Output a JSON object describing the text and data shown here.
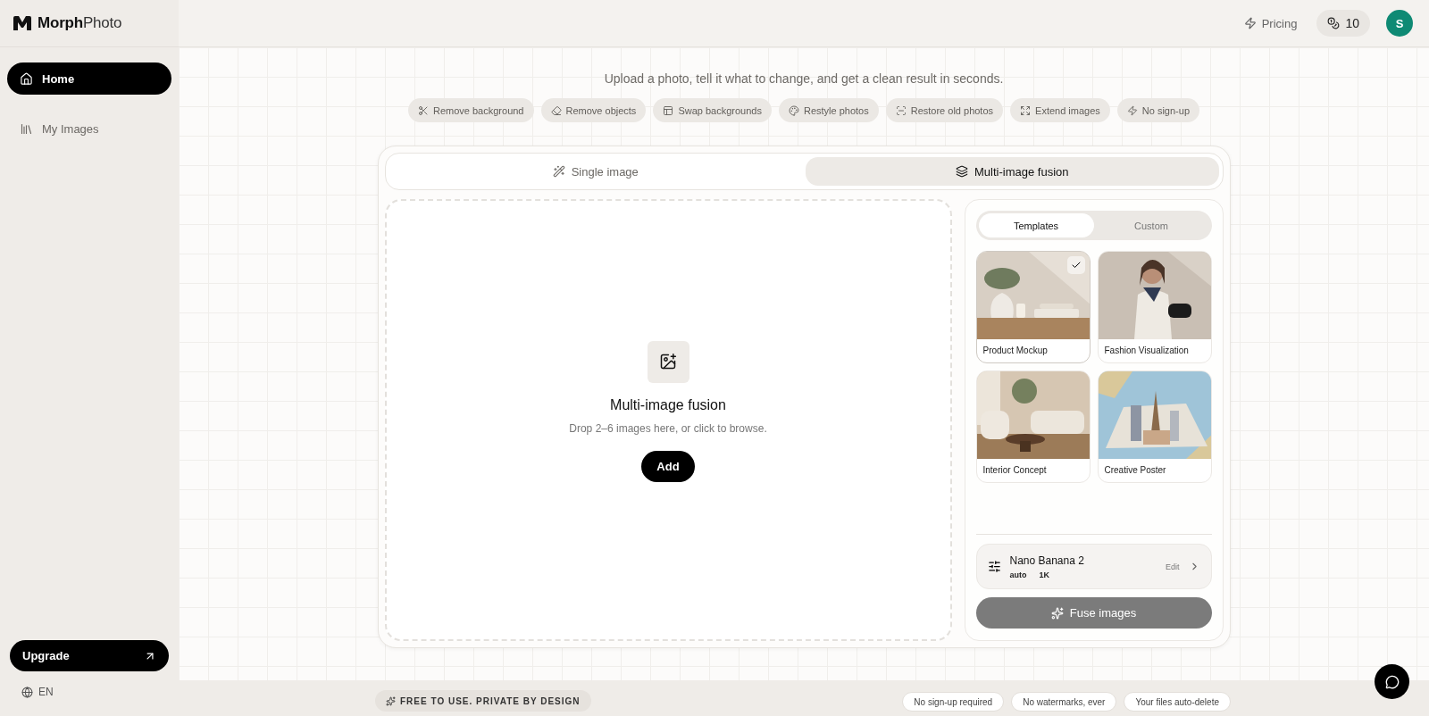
{
  "brand": {
    "bold": "Morph",
    "light": "Photo"
  },
  "sidebar": {
    "items": [
      {
        "label": "Home",
        "selected": true
      },
      {
        "label": "My Images",
        "selected": false
      }
    ],
    "upgrade": "Upgrade",
    "language": "EN"
  },
  "header": {
    "pricing": "Pricing",
    "credits": "10",
    "avatar": "S"
  },
  "subtitle": "Upload a photo, tell it what to change, and get a clean result in seconds.",
  "features": [
    "Remove background",
    "Remove objects",
    "Swap backgrounds",
    "Restyle photos",
    "Restore old photos",
    "Extend images",
    "No sign-up"
  ],
  "mode_tabs": [
    {
      "label": "Single image",
      "selected": false
    },
    {
      "label": "Multi-image fusion",
      "selected": true
    }
  ],
  "dropzone": {
    "title": "Multi-image fusion",
    "hint": "Drop 2–6 images here, or click to browse.",
    "button": "Add"
  },
  "panel_tabs": [
    {
      "label": "Templates",
      "selected": true
    },
    {
      "label": "Custom",
      "selected": false
    }
  ],
  "templates": [
    {
      "label": "Product Mockup",
      "selected": true
    },
    {
      "label": "Fashion Visualization",
      "selected": false
    },
    {
      "label": "Interior Concept",
      "selected": false
    },
    {
      "label": "Creative Poster",
      "selected": false
    }
  ],
  "model": {
    "name": "Nano Banana 2",
    "options": [
      "auto",
      "1K"
    ],
    "action": "Edit"
  },
  "fuse_button": {
    "label": "Fuse images",
    "disabled": true
  },
  "footer": {
    "tagline": "FREE TO USE. PRIVATE BY DESIGN",
    "badges": [
      "No sign-up required",
      "No watermarks, ever",
      "Your files auto-delete"
    ]
  }
}
